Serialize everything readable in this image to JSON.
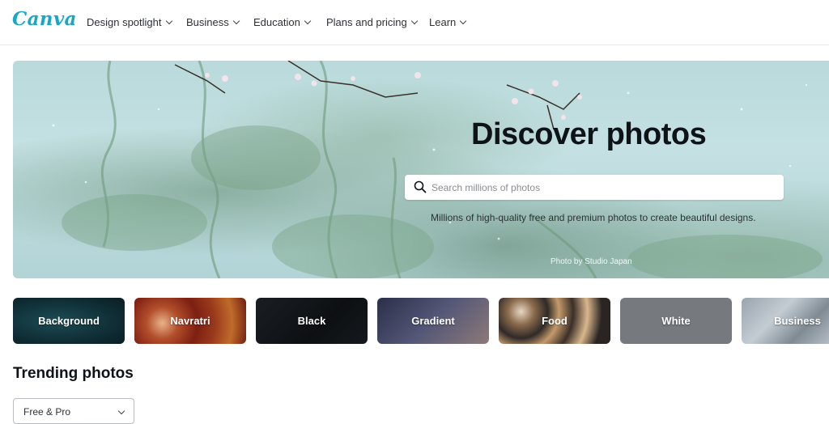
{
  "brand": {
    "logo_text": "Canva"
  },
  "nav": {
    "items": [
      {
        "label": "Design spotlight"
      },
      {
        "label": "Business"
      },
      {
        "label": "Education"
      },
      {
        "label": "Plans and pricing"
      },
      {
        "label": "Learn"
      }
    ]
  },
  "hero": {
    "title": "Discover photos",
    "search_placeholder": "Search millions of photos",
    "subtitle": "Millions of high-quality free and premium photos to create beautiful designs.",
    "credit": "Photo by Studio Japan"
  },
  "categories": [
    {
      "label": "Background"
    },
    {
      "label": "Navratri"
    },
    {
      "label": "Black"
    },
    {
      "label": "Gradient"
    },
    {
      "label": "Food"
    },
    {
      "label": "White"
    },
    {
      "label": "Business"
    }
  ],
  "trending": {
    "heading": "Trending photos",
    "filter_value": "Free & Pro"
  }
}
